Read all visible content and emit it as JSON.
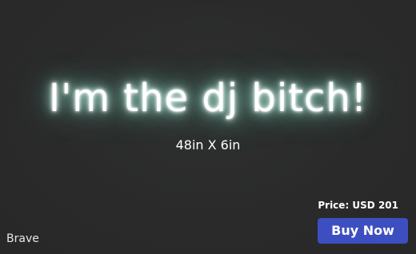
{
  "sign": {
    "text": "I'm the dj bitch!",
    "size": "48in X 6in",
    "font": "Brave",
    "glow_color": "#8de3c9"
  },
  "purchase": {
    "price_label": "Price: USD 201",
    "buy_label": "Buy Now",
    "button_color": "#3d4fc0"
  }
}
